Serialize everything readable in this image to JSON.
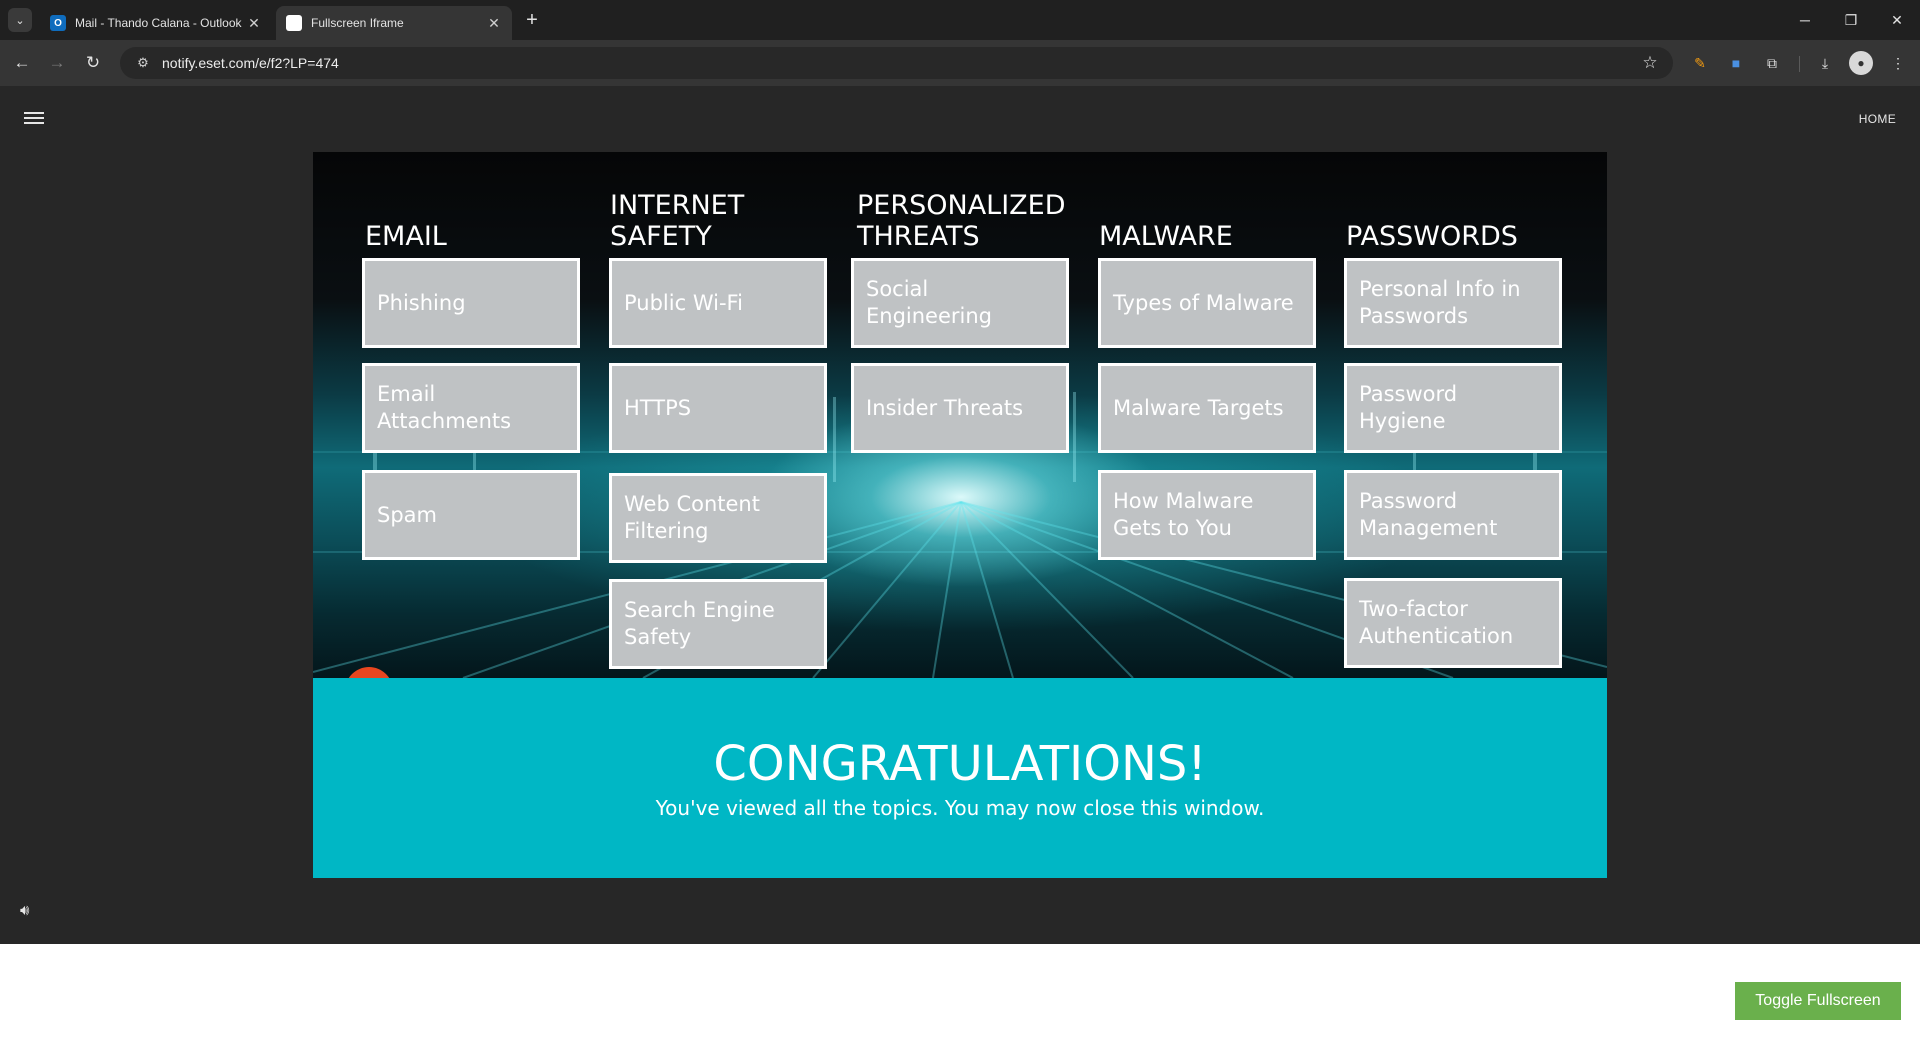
{
  "browser": {
    "tabs": [
      {
        "title": "Mail - Thando Calana - Outlook",
        "favicon": "O",
        "active": false
      },
      {
        "title": "Fullscreen Iframe",
        "favicon": "",
        "active": true
      }
    ],
    "url": "notify.eset.com/e/f2?LP=474"
  },
  "page": {
    "home_label": "HOME"
  },
  "columns": [
    {
      "heading": "EMAIL",
      "topics": [
        "Phishing",
        "Email Attachments",
        "Spam"
      ]
    },
    {
      "heading": "INTERNET SAFETY",
      "topics": [
        "Public Wi-Fi",
        "HTTPS",
        "Web Content Filtering",
        "Search Engine Safety"
      ]
    },
    {
      "heading": "PERSONALIZED THREATS",
      "topics": [
        "Social Engineering",
        "Insider Threats"
      ]
    },
    {
      "heading": "MALWARE",
      "topics": [
        "Types of Malware",
        "Malware Targets",
        "How Malware Gets to You"
      ]
    },
    {
      "heading": "PASSWORDS",
      "topics": [
        "Personal Info in Passwords",
        "Password Hygiene",
        "Password Management",
        "Two-factor Authentication"
      ]
    }
  ],
  "congrats": {
    "title": "CONGRATULATIONS!",
    "message": "You've viewed all the topics. You may now close this window."
  },
  "toggle_button": "Toggle Fullscreen",
  "colors": {
    "banner": "#00b7c5",
    "topic_tile": "#bfc2c4",
    "toggle_button": "#6ab04c",
    "page_bg": "#272727"
  }
}
